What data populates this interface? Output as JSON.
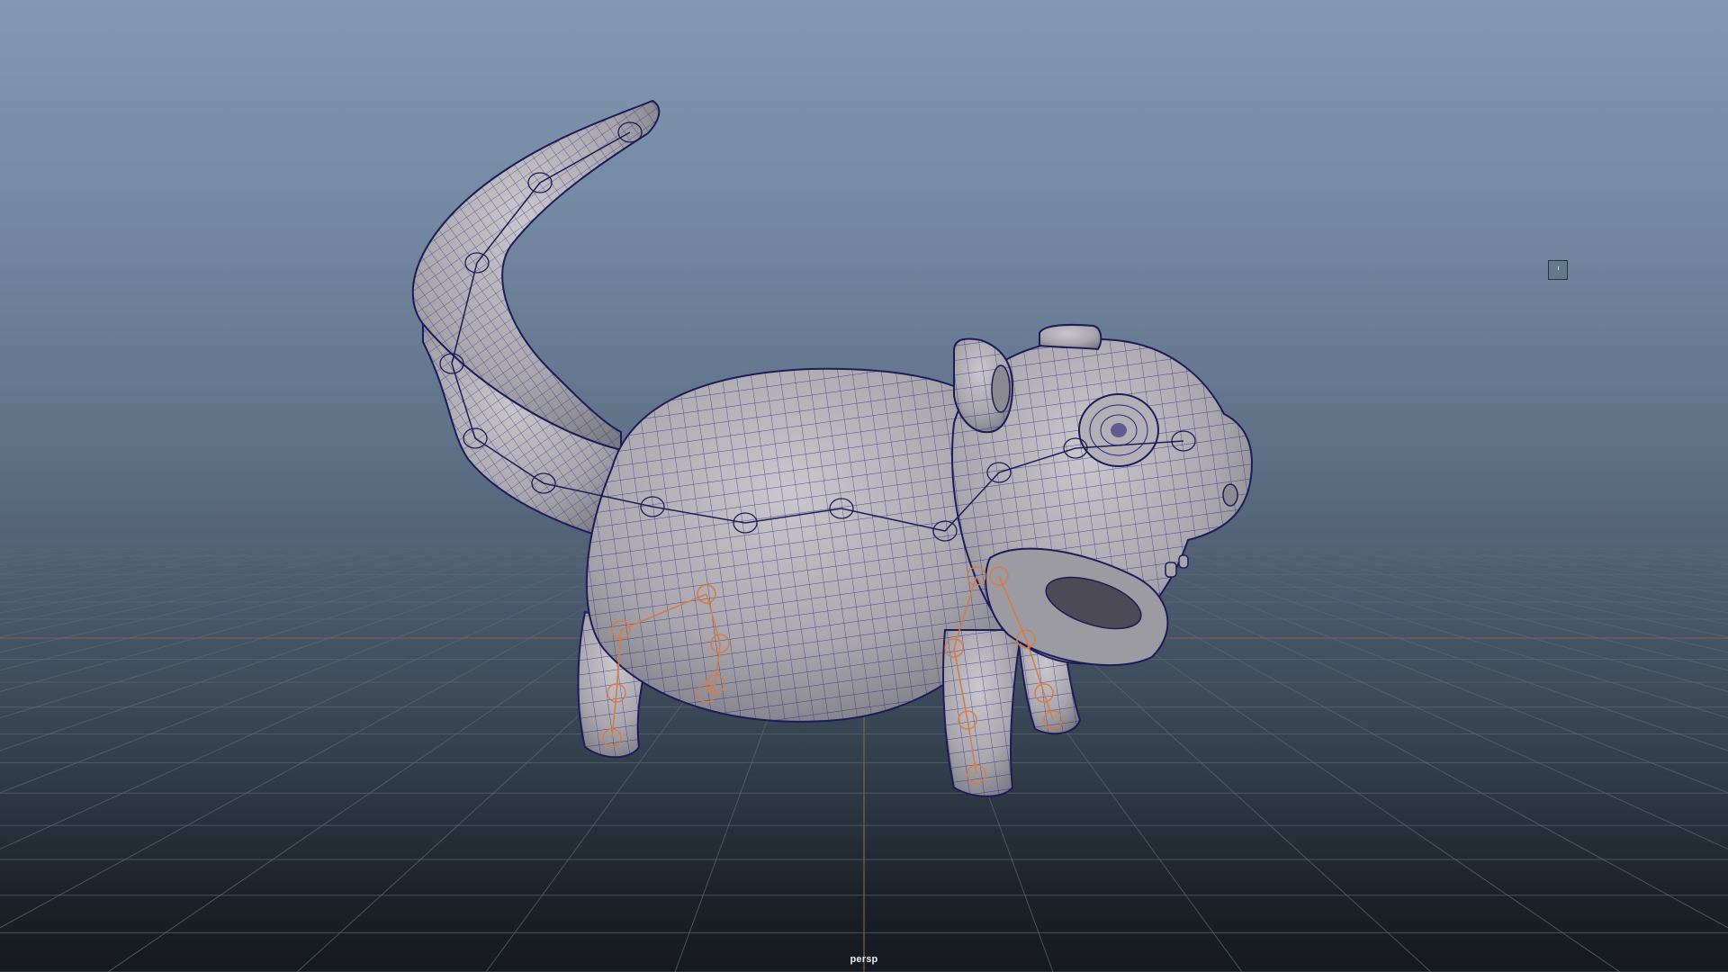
{
  "viewport": {
    "camera_label": "persp",
    "background_top": "#8299b1",
    "background_bottom": "#15191d",
    "grid_color": "#5b6672",
    "grid_axis_color": "#8a6a55",
    "mesh_fill": "#a7a5ab",
    "mesh_wire_color": "#27247a",
    "joint_color": "#d97a45"
  },
  "scene": {
    "object": "rat-character-mesh",
    "display": "wireframe-on-shaded",
    "skeleton_visible": true
  }
}
